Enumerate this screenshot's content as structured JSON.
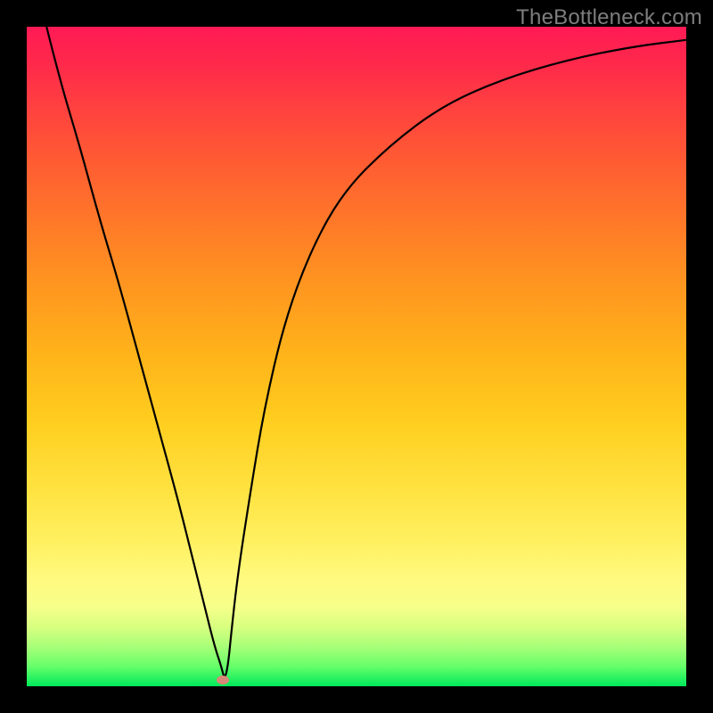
{
  "watermark": "TheBottleneck.com",
  "chart_data": {
    "type": "line",
    "title": "",
    "xlabel": "",
    "ylabel": "",
    "xlim": [
      0,
      100
    ],
    "ylim": [
      0,
      100
    ],
    "x": [
      3,
      5,
      8,
      11,
      14,
      17,
      20,
      23,
      25,
      27,
      28.5,
      29.5,
      30,
      30.5,
      31,
      32,
      34,
      36,
      39,
      43,
      48,
      55,
      63,
      72,
      82,
      92,
      100
    ],
    "values": [
      100,
      92,
      82,
      71,
      61,
      50,
      39,
      28,
      20,
      12,
      6,
      3,
      1,
      3,
      8,
      17,
      30,
      42,
      55,
      66,
      75,
      82,
      88,
      92,
      95,
      97,
      98
    ],
    "series": [
      {
        "name": "bottleneck-curve",
        "x": [
          3,
          5,
          8,
          11,
          14,
          17,
          20,
          23,
          25,
          27,
          28.5,
          29.5,
          30,
          30.5,
          31,
          32,
          34,
          36,
          39,
          43,
          48,
          55,
          63,
          72,
          82,
          92,
          100
        ],
        "values": [
          100,
          92,
          82,
          71,
          61,
          50,
          39,
          28,
          20,
          12,
          6,
          3,
          1,
          3,
          8,
          17,
          30,
          42,
          55,
          66,
          75,
          82,
          88,
          92,
          95,
          97,
          98
        ]
      }
    ],
    "marker": {
      "x": 29.7,
      "y": 1,
      "color": "#d88878"
    },
    "colors": {
      "curve": "#000000",
      "frame": "#000000",
      "gradient_top": "#ff1a55",
      "gradient_bottom": "#00e85a"
    }
  }
}
